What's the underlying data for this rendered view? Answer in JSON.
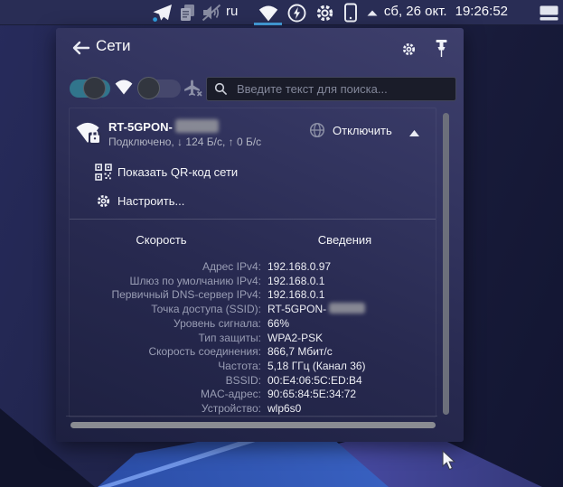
{
  "panel": {
    "keyboard_layout": "ru",
    "date": "сб, 26 окт.",
    "time": "19:26:52",
    "tray_icons": [
      "telegram-icon",
      "clipboard-icon",
      "audio-muted-icon",
      "keyboard-layout",
      "wifi-icon",
      "power-profile-icon",
      "settings-icon",
      "phone-icon",
      "expand-tray-arrow",
      "show-panel-icon"
    ],
    "active_applet": "wifi",
    "accent_color": "#45a2e0"
  },
  "popup": {
    "title": "Сети",
    "search_placeholder": "Введите текст для поиска...",
    "toggles": {
      "wifi_on": true,
      "airplane_on": false,
      "on_color": "#31758c"
    },
    "network": {
      "ssid_prefix": "RT-5GPON-",
      "status": "Подключено, ↓ 124 Б/с, ↑ 0 Б/с",
      "disconnect_label": "Отключить",
      "qr_label": "Показать QR-код сети",
      "configure_label": "Настроить..."
    },
    "tabs": [
      {
        "label": "Скорость"
      },
      {
        "label": "Сведения",
        "active": true
      }
    ],
    "details": [
      {
        "label": "Адрес IPv4:",
        "value": "192.168.0.97"
      },
      {
        "label": "Шлюз по умолчанию IPv4:",
        "value": "192.168.0.1"
      },
      {
        "label": "Первичный DNS-сервер IPv4:",
        "value": "192.168.0.1"
      },
      {
        "label": "Точка доступа (SSID):",
        "value": "RT-5GPON-",
        "redacted": true
      },
      {
        "label": "Уровень сигнала:",
        "value": "66%"
      },
      {
        "label": "Тип защиты:",
        "value": "WPA2-PSK"
      },
      {
        "label": "Скорость соединения:",
        "value": "866,7 Мбит/с"
      },
      {
        "label": "Частота:",
        "value": "5,18 ГГц (Канал 36)"
      },
      {
        "label": "BSSID:",
        "value": "00:E4:06:5C:ED:B4"
      },
      {
        "label": "MAC-адрес:",
        "value": "90:65:84:5E:34:72"
      },
      {
        "label": "Устройство:",
        "value": "wlp6s0"
      }
    ]
  }
}
